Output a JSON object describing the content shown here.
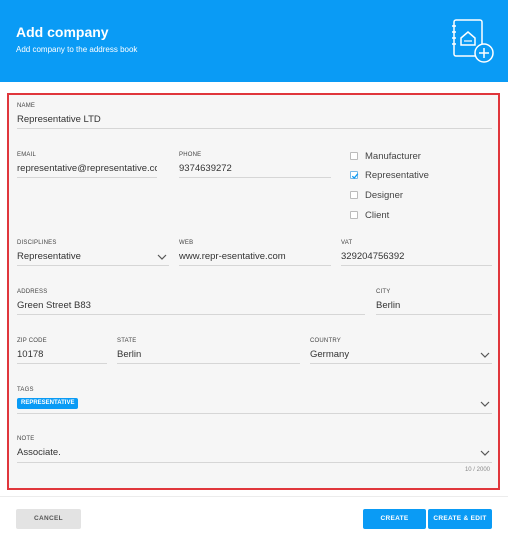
{
  "header": {
    "title": "Add company",
    "subtitle": "Add company to the address book",
    "icon": "address-book-add-icon",
    "background": "#0a9bf5"
  },
  "form": {
    "name": {
      "label": "NAME",
      "value": "Representative LTD"
    },
    "email": {
      "label": "EMAIL",
      "value": "representative@representative.com"
    },
    "phone": {
      "label": "PHONE",
      "value": "9374639272"
    },
    "types": [
      {
        "label": "Manufacturer",
        "checked": false
      },
      {
        "label": "Representative",
        "checked": true
      },
      {
        "label": "Designer",
        "checked": false
      },
      {
        "label": "Client",
        "checked": false
      }
    ],
    "disciplines": {
      "label": "DISCIPLINES",
      "value": "Representative"
    },
    "web": {
      "label": "WEB",
      "value": "www.repr-esentative.com"
    },
    "vat": {
      "label": "VAT",
      "value": "329204756392"
    },
    "address": {
      "label": "ADDRESS",
      "value": "Green Street B83"
    },
    "city": {
      "label": "CITY",
      "value": "Berlin"
    },
    "zip": {
      "label": "ZIP CODE",
      "value": "10178"
    },
    "state": {
      "label": "STATE",
      "value": "Berlin"
    },
    "country": {
      "label": "COUNTRY",
      "value": "Germany"
    },
    "tags": {
      "label": "TAGS",
      "items": [
        "REPRESENTATIVE"
      ]
    },
    "note": {
      "label": "NOTE",
      "value": "Associate.",
      "counter": "10 / 2000"
    }
  },
  "footer": {
    "cancel_label": "CANCEL",
    "create_label": "CREATE",
    "create_edit_label": "CREATE & EDIT"
  },
  "colors": {
    "accent": "#0a9bf5",
    "highlight_border": "#e0363c"
  }
}
